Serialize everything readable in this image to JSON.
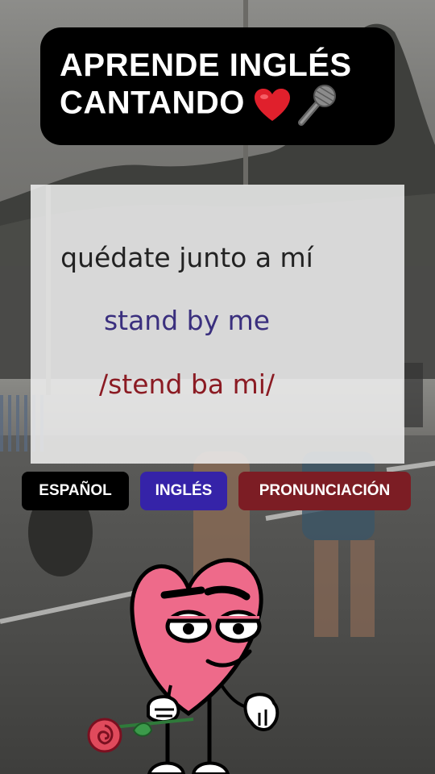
{
  "title": {
    "line1": "APRENDE INGLÉS",
    "line2": "CANTANDO",
    "icons": [
      "heart-icon",
      "microphone-icon"
    ]
  },
  "lyrics": {
    "spanish": "quédate junto a mí",
    "english": "stand by me",
    "pronunciation": "/stend ba mi/"
  },
  "legend": [
    {
      "label": "ESPAÑOL",
      "color": "#000000"
    },
    {
      "label": "INGLÉS",
      "color": "#3523a8"
    },
    {
      "label": "PRONUNCIACIÓN",
      "color": "#7c1d24"
    }
  ],
  "colors": {
    "heart": "#ee6a8a",
    "heart_icon": "#e0202c",
    "spanish_text": "#222222",
    "english_text": "#3a2f7e",
    "pronunciation_text": "#8b1b23"
  },
  "mascot": {
    "name": "heart-character-with-rose"
  }
}
